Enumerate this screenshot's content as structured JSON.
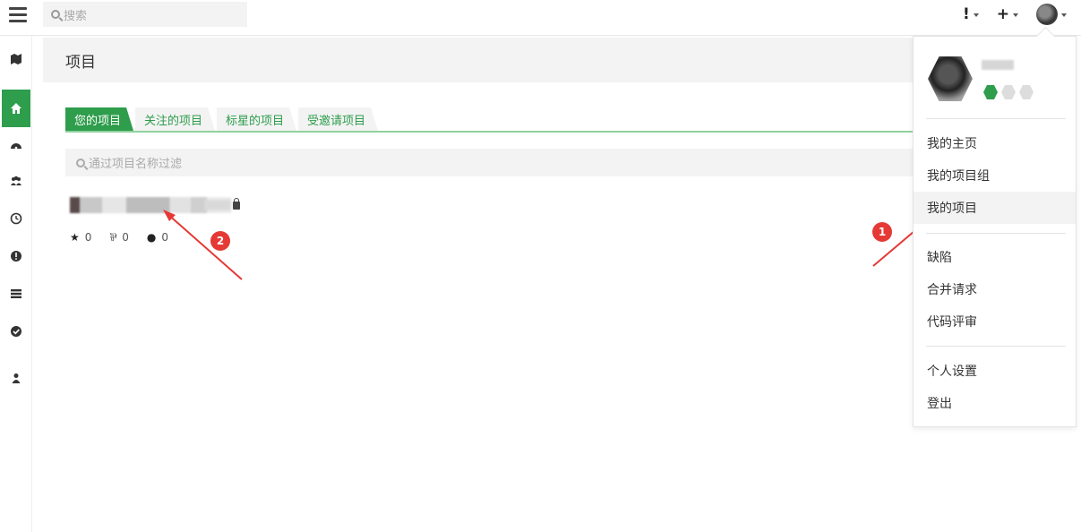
{
  "topbar": {
    "search_placeholder": "搜索",
    "issues_label": "!",
    "add_label": "+"
  },
  "sidebar": {
    "items": [
      "map-icon",
      "home-icon",
      "dashboard-icon",
      "groups-icon",
      "activity-icon",
      "issues-icon",
      "snippets-icon",
      "todo-icon",
      "profile-icon"
    ],
    "active": "home-icon"
  },
  "page": {
    "title": "项目"
  },
  "tabs": [
    {
      "label": "您的项目",
      "active": true
    },
    {
      "label": "关注的项目",
      "active": false
    },
    {
      "label": "标星的项目",
      "active": false
    },
    {
      "label": "受邀请项目",
      "active": false
    }
  ],
  "filter": {
    "placeholder": "通过项目名称过滤"
  },
  "project": {
    "stars": "0",
    "forks": "0",
    "comments": "0"
  },
  "markers": {
    "one": "1",
    "two": "2"
  },
  "dropdown": {
    "items": [
      "我的主页",
      "我的项目组",
      "我的项目",
      "缺陷",
      "合并请求",
      "代码评审",
      "个人设置",
      "登出"
    ],
    "highlighted": "我的项目"
  },
  "colors": {
    "accent": "#2e9d4c",
    "marker": "#e53935"
  }
}
